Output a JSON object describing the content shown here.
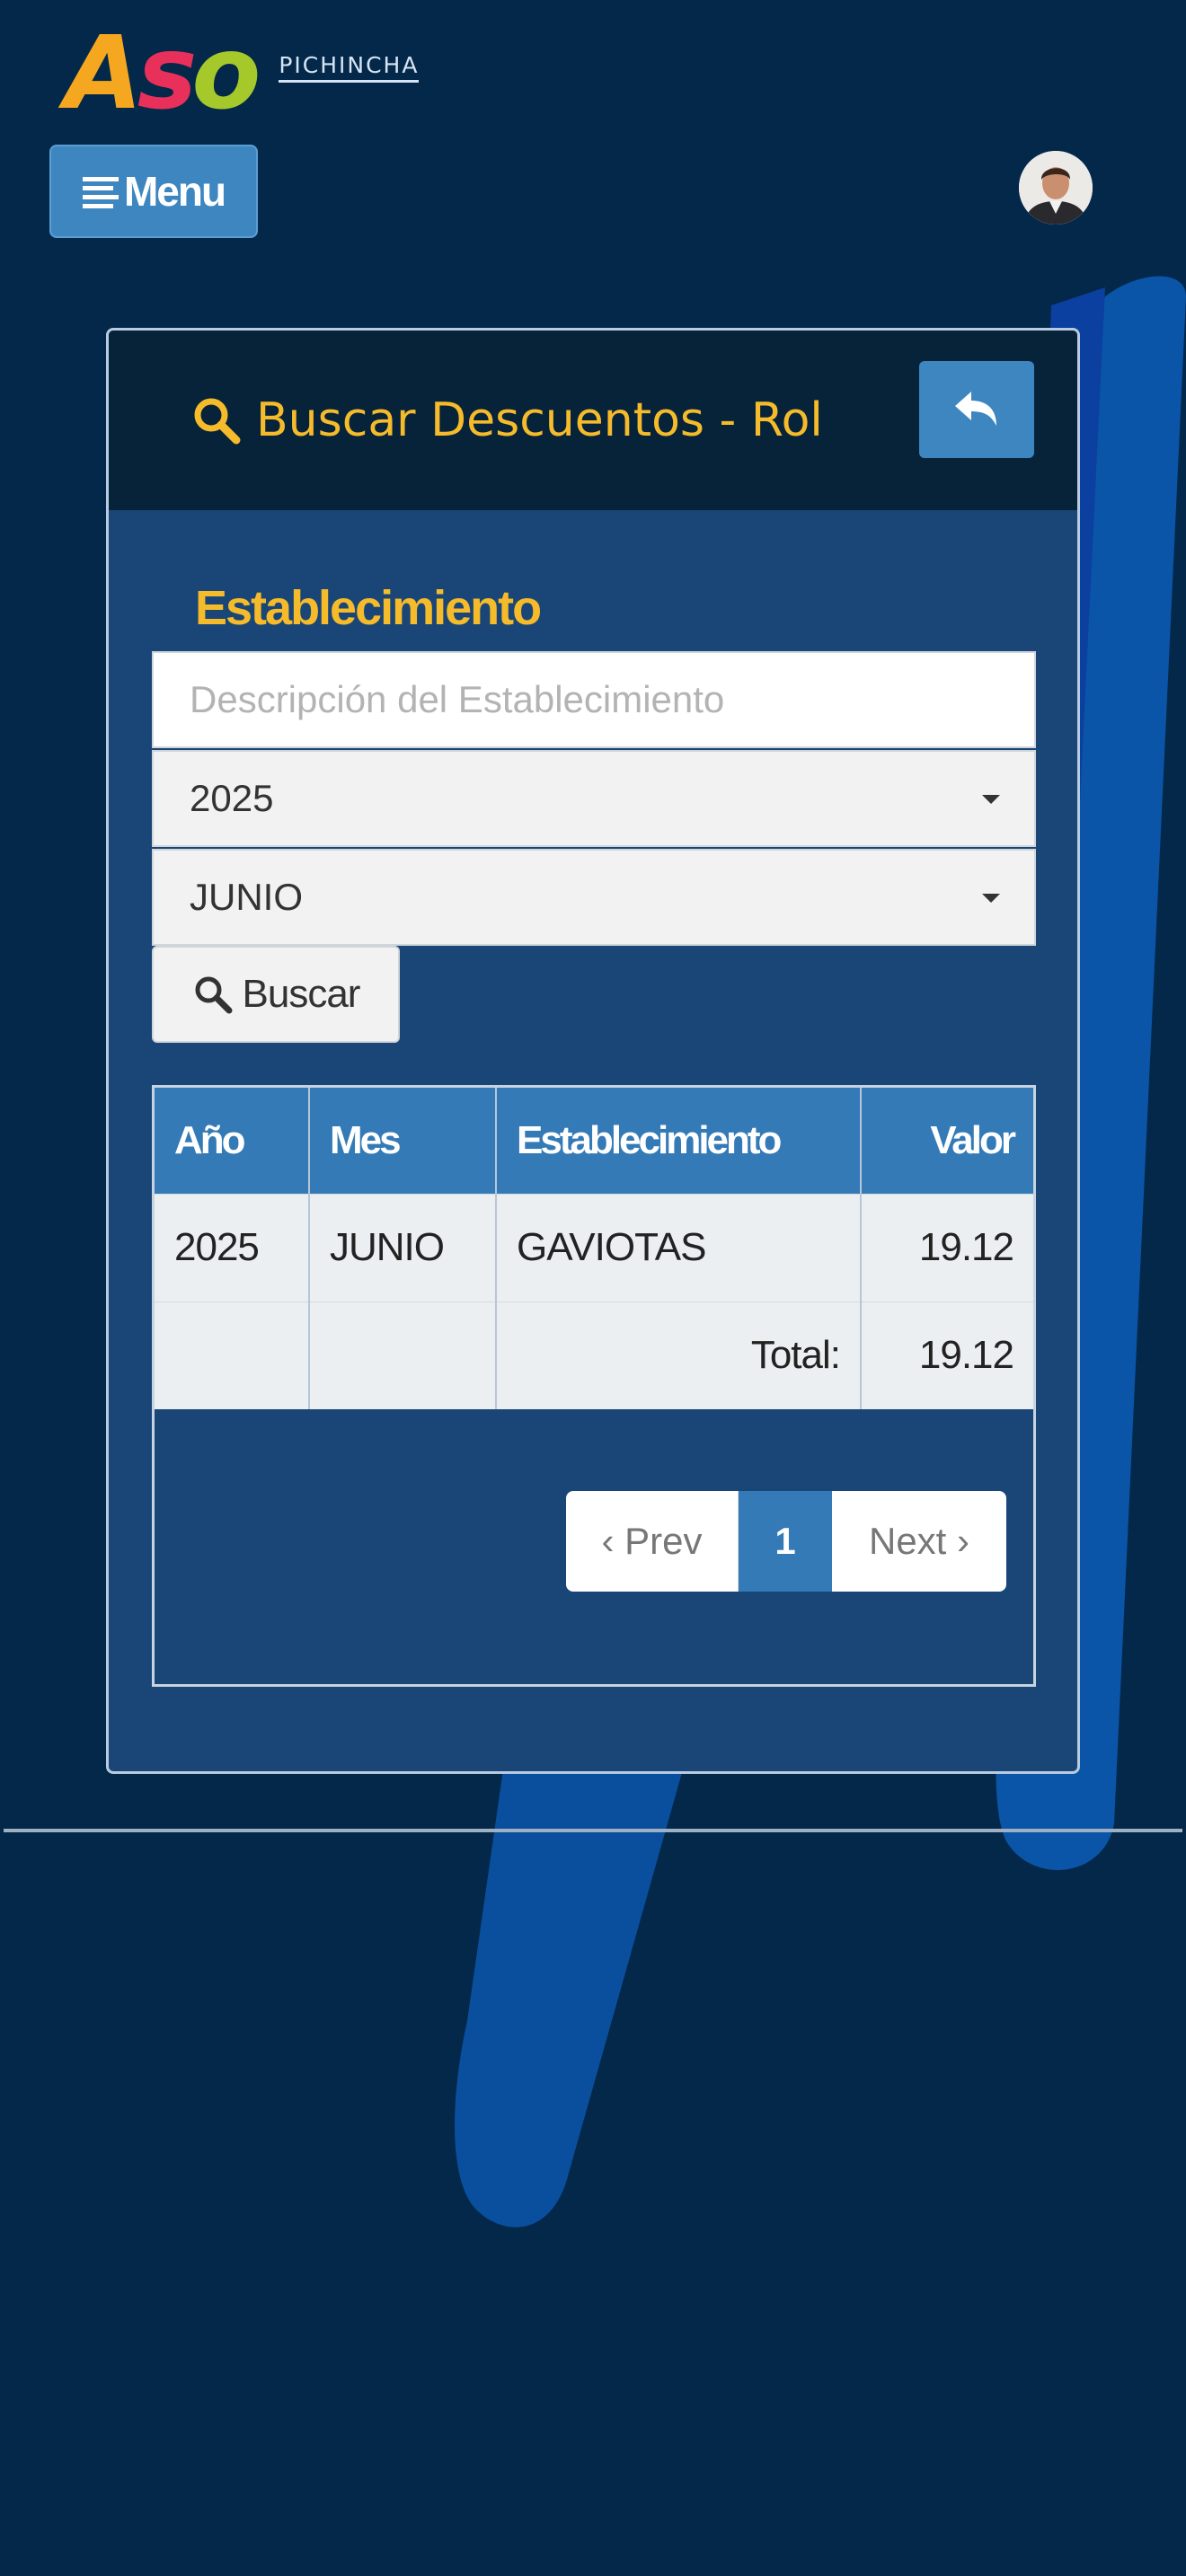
{
  "header": {
    "logo_text": "ASO",
    "logo_subtitle": "PICHINCHA",
    "menu_label": "Menu"
  },
  "panel": {
    "title": "Buscar Descuentos - Rol"
  },
  "form": {
    "field_label": "Establecimiento",
    "description_placeholder": "Descripción del Establecimiento",
    "year_value": "2025",
    "month_value": "JUNIO",
    "search_label": "Buscar"
  },
  "table": {
    "columns": [
      "Año",
      "Mes",
      "Establecimiento",
      "Valor"
    ],
    "rows": [
      [
        "2025",
        "JUNIO",
        "GAVIOTAS",
        "19.12"
      ]
    ],
    "total_label": "Total:",
    "total_value": "19.12"
  },
  "pagination": {
    "prev_label": "‹ Prev",
    "current_page": "1",
    "next_label": "Next ›"
  },
  "colors": {
    "background": "#04284a",
    "accent_yellow": "#f6bb2a",
    "primary_blue": "#337ab7"
  }
}
